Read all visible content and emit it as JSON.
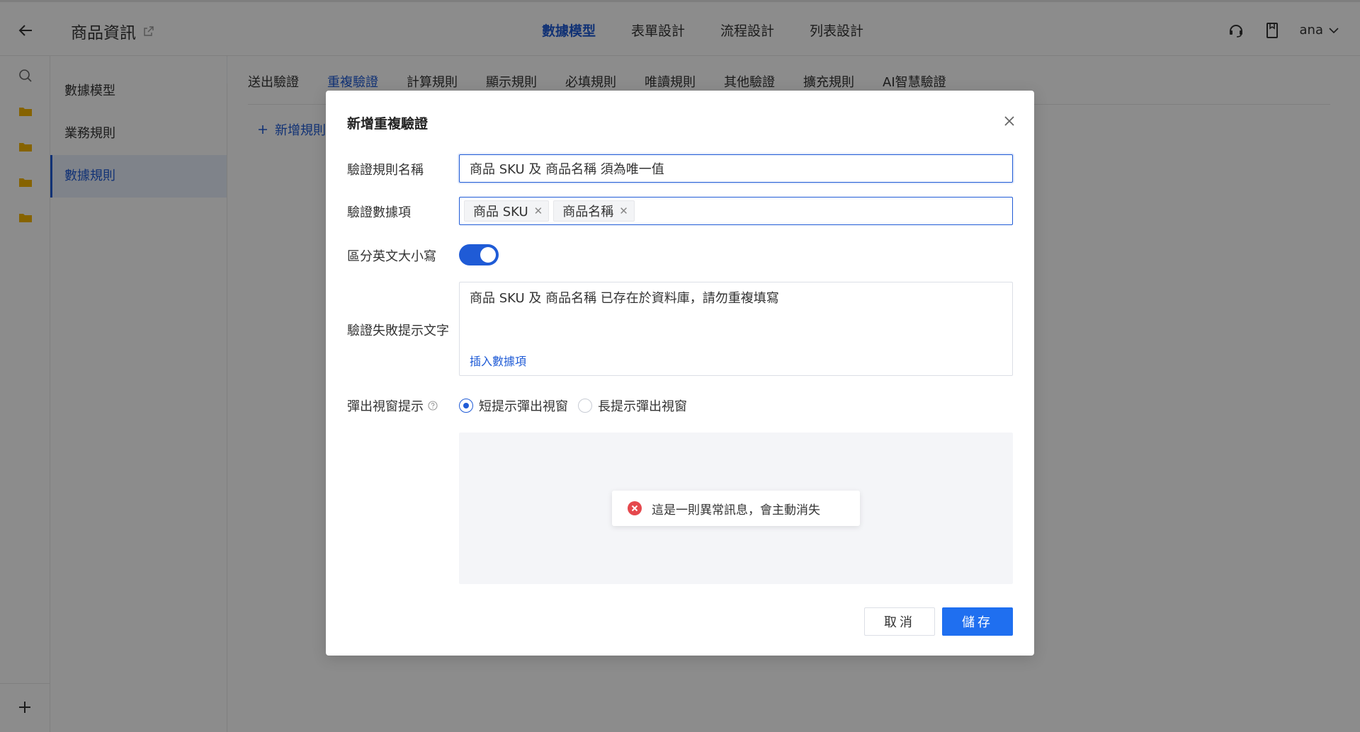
{
  "header": {
    "app_title": "商品資訊",
    "tabs": [
      {
        "label": "數據模型",
        "active": true
      },
      {
        "label": "表單設計",
        "active": false
      },
      {
        "label": "流程設計",
        "active": false
      },
      {
        "label": "列表設計",
        "active": false
      }
    ],
    "user_name": "ana"
  },
  "subnav": {
    "items": [
      {
        "label": "數據模型",
        "active": false
      },
      {
        "label": "業務規則",
        "active": false
      },
      {
        "label": "數據規則",
        "active": true
      }
    ]
  },
  "rule_tabs": [
    {
      "label": "送出驗證",
      "active": false
    },
    {
      "label": "重複驗證",
      "active": true
    },
    {
      "label": "計算規則",
      "active": false
    },
    {
      "label": "顯示規則",
      "active": false
    },
    {
      "label": "必填規則",
      "active": false
    },
    {
      "label": "唯讀規則",
      "active": false
    },
    {
      "label": "其他驗證",
      "active": false
    },
    {
      "label": "擴充規則",
      "active": false
    },
    {
      "label": "AI智慧驗證",
      "active": false
    }
  ],
  "add_rule_label": "新增規則",
  "modal": {
    "title": "新增重複驗證",
    "name_label": "驗證規則名稱",
    "name_value": "商品 SKU 及 商品名稱 須為唯一值",
    "fields_label": "驗證數據項",
    "field_tags": [
      "商品 SKU",
      "商品名稱"
    ],
    "case_label": "區分英文大小寫",
    "case_sensitive": true,
    "message_label": "驗證失敗提示文字",
    "message_value": "商品 SKU 及 商品名稱 已存在於資料庫，請勿重複填寫",
    "insert_field_link": "插入數據項",
    "popup_label": "彈出視窗提示",
    "popup_options": [
      {
        "label": "短提示彈出視窗",
        "checked": true
      },
      {
        "label": "長提示彈出視窗",
        "checked": false
      }
    ],
    "preview_toast": "這是一則異常訊息，會主動消失",
    "cancel_label": "取消",
    "save_label": "儲存"
  },
  "colors": {
    "accent": "#1f5bd6",
    "primary_button": "#1f6ff0",
    "error": "#e5484d",
    "folder": "#f5b400"
  },
  "icons": [
    "back-arrow-icon",
    "external-link-icon",
    "headset-icon",
    "bookmark-icon",
    "chevron-down-icon",
    "search-icon",
    "folder-icon",
    "plus-icon",
    "close-icon",
    "help-icon",
    "error-icon",
    "chevron-left-icon"
  ]
}
